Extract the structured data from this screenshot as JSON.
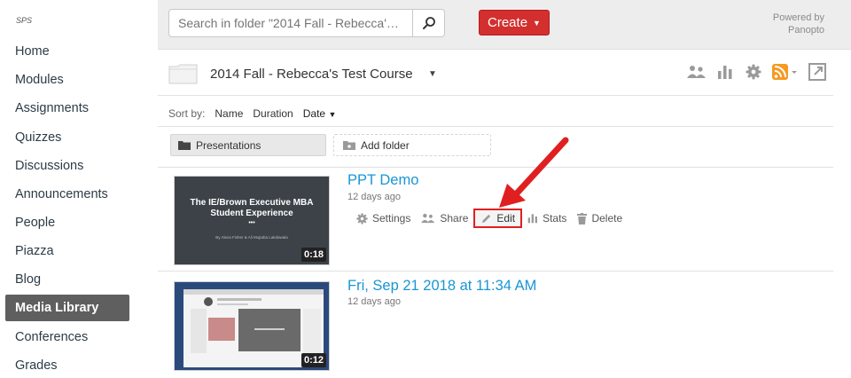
{
  "sidebar": {
    "course_code": "SPS",
    "items": [
      {
        "label": "Home"
      },
      {
        "label": "Modules"
      },
      {
        "label": "Assignments"
      },
      {
        "label": "Quizzes"
      },
      {
        "label": "Discussions"
      },
      {
        "label": "Announcements"
      },
      {
        "label": "People"
      },
      {
        "label": "Piazza"
      },
      {
        "label": "Blog"
      },
      {
        "label": "Media Library"
      },
      {
        "label": "Conferences"
      },
      {
        "label": "Grades"
      }
    ],
    "active_item": "Media Library"
  },
  "topbar": {
    "search_placeholder": "Search in folder \"2014 Fall - Rebecca'…",
    "create_label": "Create",
    "powered_line1": "Powered by",
    "powered_line2": "Panopto"
  },
  "folder": {
    "title": "2014 Fall - Rebecca's Test Course"
  },
  "sort": {
    "label": "Sort by:",
    "options": [
      "Name",
      "Duration",
      "Date"
    ],
    "active": "Date"
  },
  "buttons": {
    "presentations": "Presentations",
    "add_folder": "Add folder"
  },
  "sessions": [
    {
      "title": "PPT Demo",
      "age": "12 days ago",
      "duration": "0:18",
      "thumb_title_line1": "The IE/Brown Executive MBA",
      "thumb_title_line2": "Student Experience",
      "thumb_subtitle": "By Alexa Fisher & Ali Mujtaba Lakdawala",
      "actions": [
        "Settings",
        "Share",
        "Edit",
        "Stats",
        "Delete"
      ],
      "highlighted_action": "Edit"
    },
    {
      "title": "Fri, Sep 21 2018 at 11:34 AM",
      "age": "12 days ago",
      "duration": "0:12"
    }
  ],
  "colors": {
    "accent_link": "#1a96d4",
    "create_red": "#d32f2f",
    "annotation_red": "#e02020",
    "active_nav_bg": "#5f5f5f",
    "rss_orange": "#f59a23"
  }
}
